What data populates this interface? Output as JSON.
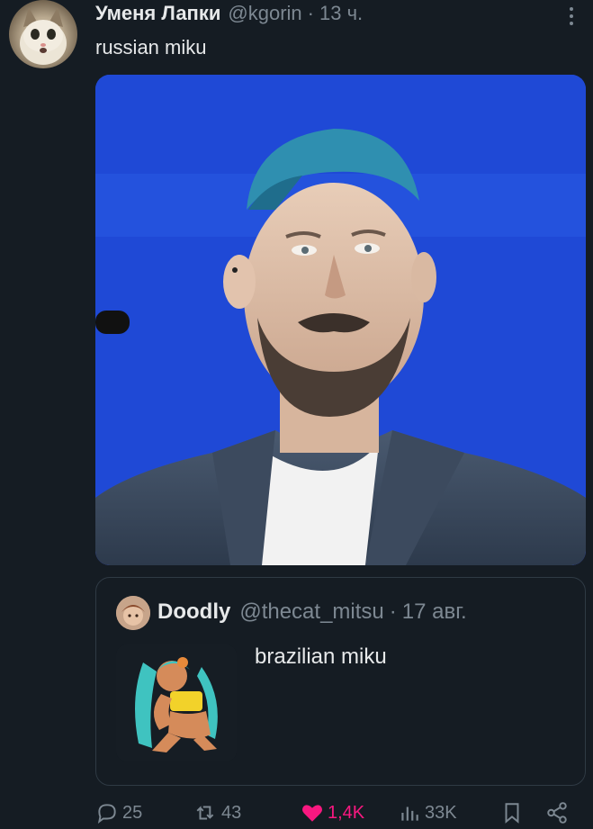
{
  "tweet": {
    "display_name": "Уменя Лапки",
    "handle": "@kgorin",
    "time": "13 ч.",
    "text": "russian miku"
  },
  "quote": {
    "display_name": "Doodly",
    "handle": "@thecat_mitsu",
    "time": "17 авг.",
    "text": "brazilian miku"
  },
  "actions": {
    "replies": "25",
    "retweets": "43",
    "likes": "1,4K",
    "views": "33K"
  },
  "separator": "·",
  "icons": {
    "more": "more-dots-icon",
    "reply": "reply-icon",
    "retweet": "retweet-icon",
    "like": "heart-icon",
    "views": "views-icon",
    "bookmark": "bookmark-icon",
    "share": "share-icon"
  },
  "colors": {
    "background": "#151c23",
    "text": "#e7e9ea",
    "secondary": "#7d8892",
    "like": "#f91880",
    "border": "#2f3a44"
  }
}
